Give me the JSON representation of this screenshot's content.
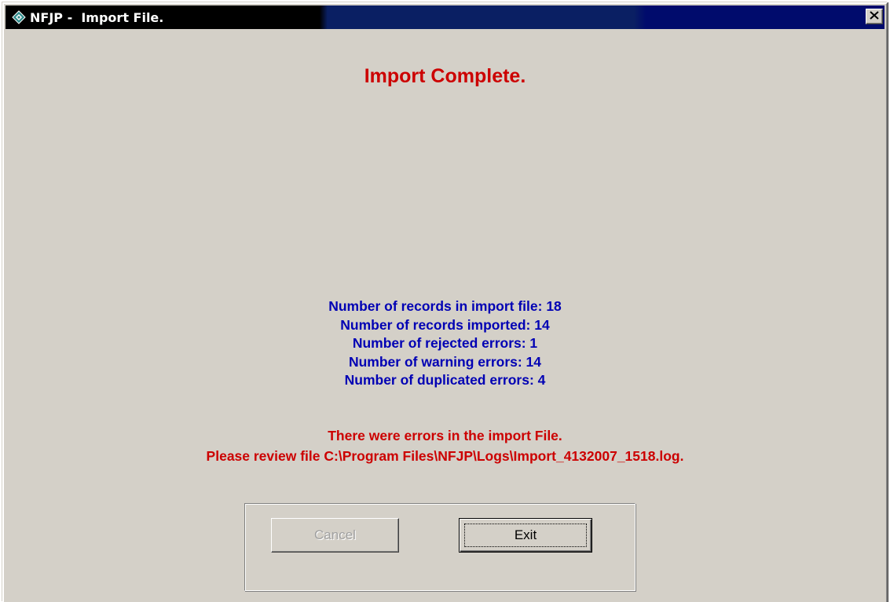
{
  "window": {
    "title": "NFJP -  Import File.",
    "icon": "diamond-app-icon",
    "close_glyph": "✕"
  },
  "heading": "Import Complete.",
  "stats": [
    "Number of records in import file: 18",
    "Number of records imported: 14",
    "Number of rejected errors: 1",
    "Number of warning errors: 14",
    "Number of duplicated errors: 4"
  ],
  "error_messages": [
    "There were errors in the import File.",
    "Please review file C:\\Program Files\\NFJP\\Logs\\Import_4132007_1518.log."
  ],
  "buttons": {
    "cancel": "Cancel",
    "exit": "Exit"
  },
  "colors": {
    "heading": "#cc0000",
    "stats": "#0000b4",
    "errors": "#cc0000",
    "dialog_background": "#d4d0c8",
    "titlebar": "#000000"
  }
}
